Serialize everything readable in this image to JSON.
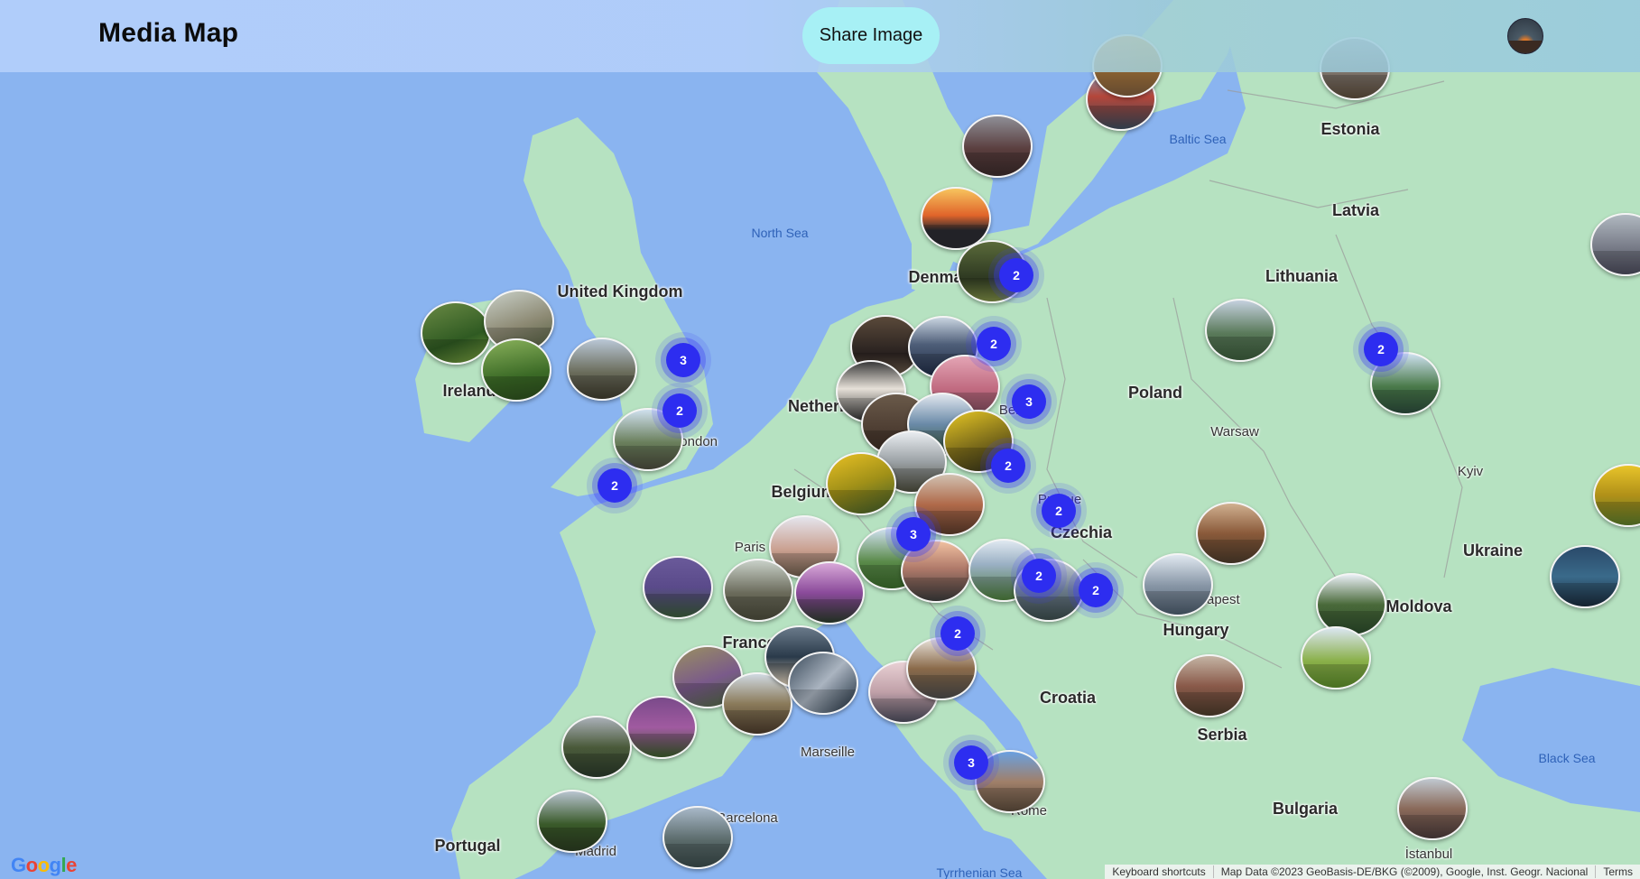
{
  "header": {
    "title": "Media Map",
    "share_label": "Share Image"
  },
  "colors": {
    "sea": "#8ab4f0",
    "land": "#b6e2c1",
    "cluster": "#2d2df0",
    "share_button": "#a7f0f5"
  },
  "map_labels": {
    "countries": [
      "United Kingdom",
      "Ireland",
      "Denmark",
      "Netherlands",
      "Belgium",
      "France",
      "Portugal",
      "Estonia",
      "Latvia",
      "Lithuania",
      "Poland",
      "Czechia",
      "Hungary",
      "Croatia",
      "Serbia",
      "Bulgaria",
      "Moldova",
      "Ukraine"
    ],
    "seas": [
      "North Sea",
      "Baltic Sea",
      "Black Sea",
      "Tyrrhenian Sea"
    ],
    "cities": [
      "London",
      "Paris",
      "Berlin",
      "Prague",
      "Warsaw",
      "Kyiv",
      "Budapest",
      "Marseille",
      "Barcelona",
      "Madrid",
      "Rome",
      "İstanbul"
    ]
  },
  "clusters": [
    "3",
    "2",
    "2",
    "2",
    "2",
    "3",
    "2",
    "2",
    "3",
    "2",
    "2",
    "2",
    "3"
  ],
  "photo_count": 47,
  "footer": {
    "google": "Google",
    "keyboard": "Keyboard shortcuts",
    "map_data": "Map Data ©2023 GeoBasis-DE/BKG (©2009), Google, Inst. Geogr. Nacional",
    "terms": "Terms"
  }
}
